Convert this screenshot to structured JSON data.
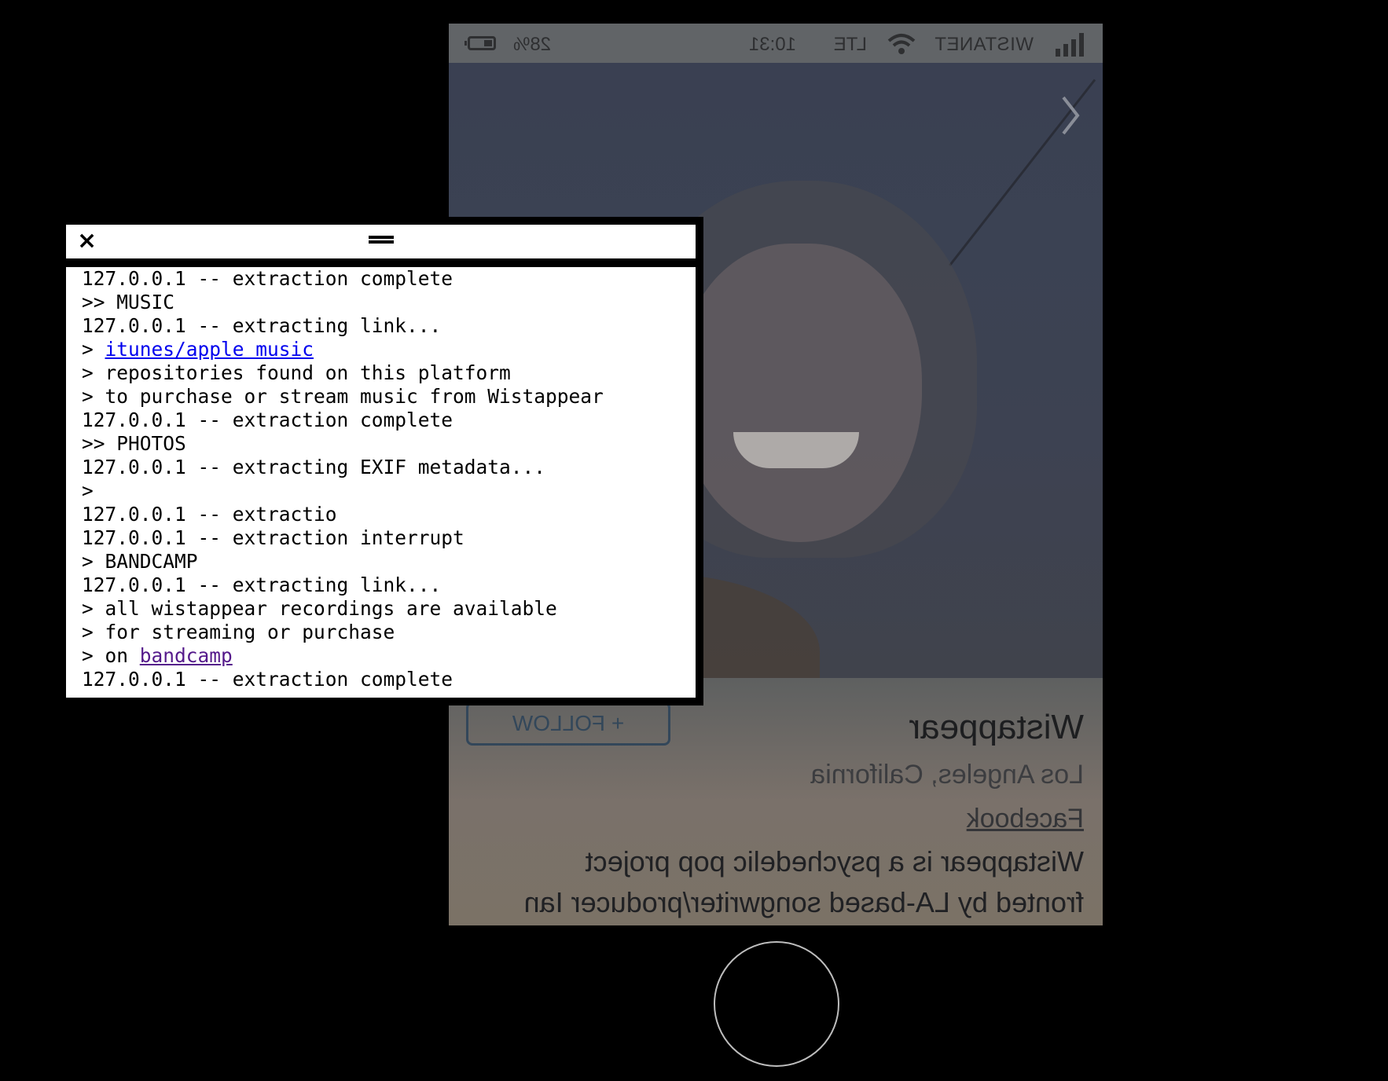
{
  "phone": {
    "status_bar": {
      "carrier": "WISTANET",
      "network": "LTE",
      "time": "10:31",
      "battery": "28%"
    },
    "profile": {
      "name": "Wistappear",
      "location": "Los Angeles, California",
      "facebook_link": "Facebook",
      "bio_line1": "Wistappear is a psychedelic pop project",
      "bio_line2": "fronted by LA-based songwriter/producer Ian",
      "follow_label": "+ FOLLOW"
    },
    "icons": {
      "signal": "signal-bars-icon",
      "wifi": "wifi-icon",
      "battery": "battery-icon",
      "next": "chevron-right-icon",
      "home": "home-button"
    }
  },
  "terminal": {
    "close_label": "×",
    "lines": [
      {
        "text": "127.0.0.1 -- extraction complete"
      },
      {
        "text": ">> MUSIC"
      },
      {
        "text": "127.0.0.1 -- extracting link..."
      },
      {
        "prefix": "> ",
        "link": "itunes/apple music",
        "link_style": "blue"
      },
      {
        "text": "> repositories found on this platform"
      },
      {
        "text": "> to purchase or stream music from Wistappear"
      },
      {
        "text": "127.0.0.1 -- extraction complete"
      },
      {
        "text": ">> PHOTOS"
      },
      {
        "text": "127.0.0.1 -- extracting EXIF metadata..."
      },
      {
        "text": ">"
      },
      {
        "text": "127.0.0.1 -- extractio"
      },
      {
        "text": "127.0.0.1 -- extraction interrupt"
      },
      {
        "text": "> BANDCAMP"
      },
      {
        "text": "127.0.0.1 -- extracting link..."
      },
      {
        "text": "> all wistappear recordings are available"
      },
      {
        "text": "> for streaming or purchase"
      },
      {
        "prefix": "> on ",
        "link": "bandcamp",
        "link_style": "visited"
      },
      {
        "text": "127.0.0.1 -- extraction complete"
      }
    ]
  },
  "colors": {
    "background": "#000000",
    "terminal_bg": "#ffffff",
    "link": "#0000ee",
    "link_visited": "#551a8b"
  }
}
